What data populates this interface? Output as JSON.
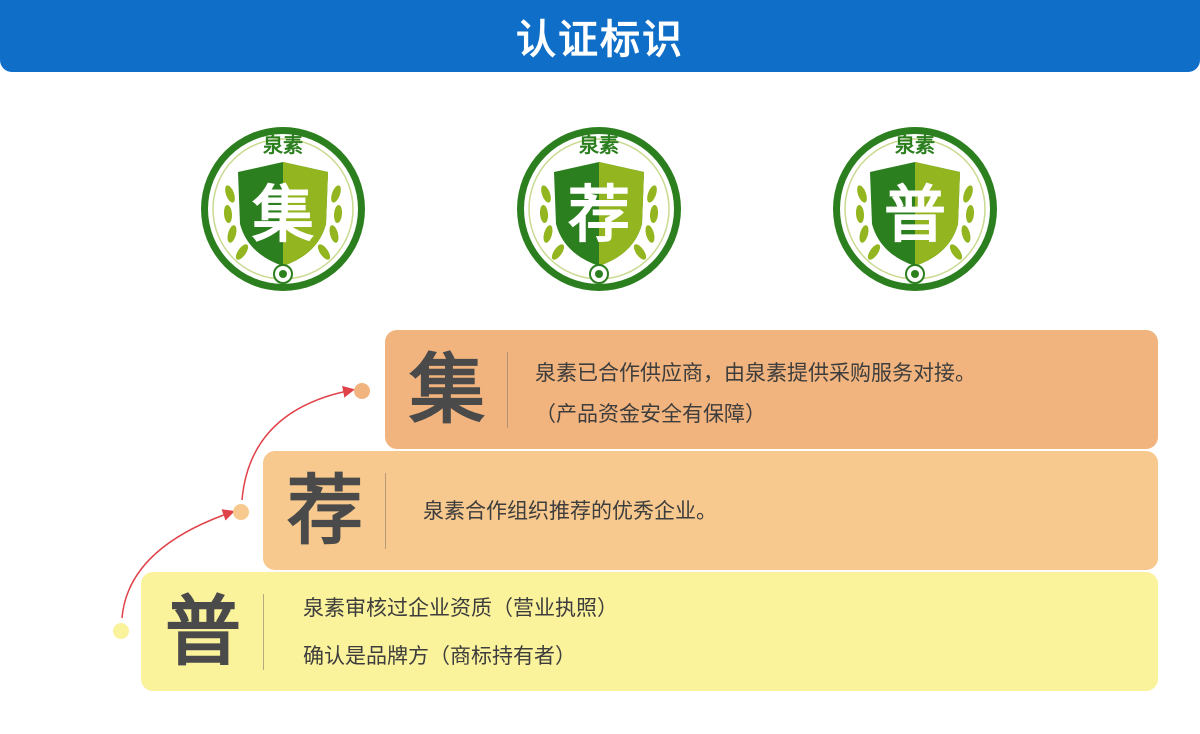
{
  "header": {
    "title": "认证标识"
  },
  "badges": [
    {
      "brand": "泉素",
      "char": "集"
    },
    {
      "brand": "泉素",
      "char": "荐"
    },
    {
      "brand": "泉素",
      "char": "普"
    }
  ],
  "tiers": [
    {
      "char": "集",
      "lines": [
        "泉素已合作供应商，由泉素提供采购服务对接。",
        "（产品资金安全有保障）"
      ]
    },
    {
      "char": "荐",
      "lines": [
        "泉素合作组织推荐的优秀企业。"
      ]
    },
    {
      "char": "普",
      "lines": [
        "泉素审核过企业资质（营业执照）",
        "确认是品牌方（商标持有者）"
      ]
    }
  ],
  "colors": {
    "header_bg": "#0f6ec8",
    "badge_dark_green": "#2c7f1e",
    "badge_light_green": "#93b51f",
    "tier_ji_bg": "#f2b47e",
    "tier_jian_bg": "#f7c98e",
    "tier_pu_bg": "#fbf29c",
    "path_line": "#e0424a"
  }
}
